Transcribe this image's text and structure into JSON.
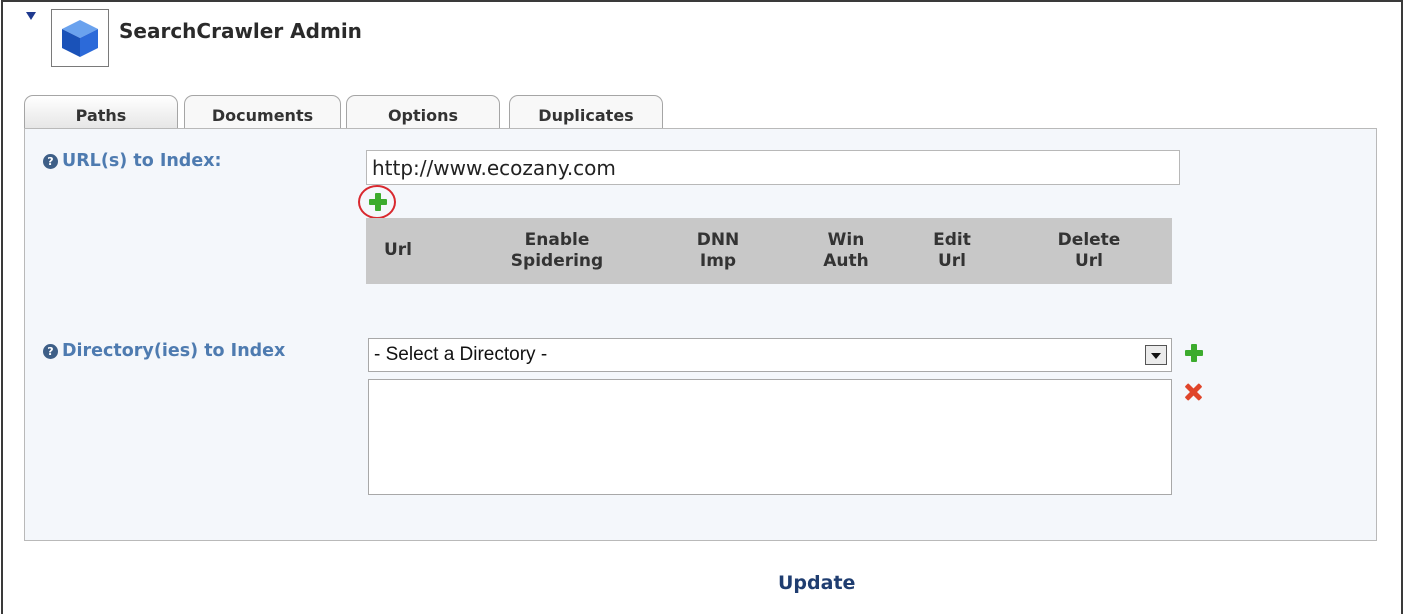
{
  "module": {
    "title": "SearchCrawler Admin",
    "icon": "cube-icon",
    "collapse_icon": "collapse-triangle-icon"
  },
  "tabs": [
    {
      "label": "Paths",
      "active": true
    },
    {
      "label": "Documents",
      "active": false
    },
    {
      "label": "Options",
      "active": false
    },
    {
      "label": "Duplicates",
      "active": false
    }
  ],
  "paths": {
    "url_label": "URL(s) to Index:",
    "url_value": "http://www.ecozany.com",
    "url_columns": [
      "Url",
      "Enable\nSpidering",
      "DNN\nImp",
      "Win\nAuth",
      "Edit\nUrl",
      "Delete\nUrl"
    ],
    "directory_label": "Directory(ies) to Index",
    "directory_select": "- Select a Directory -"
  },
  "actions": {
    "update": "Update"
  },
  "colors": {
    "label": "#4e7bb0",
    "add": "#3cab2d",
    "delete": "#e0452a",
    "highlight_ring": "#d9292f"
  }
}
